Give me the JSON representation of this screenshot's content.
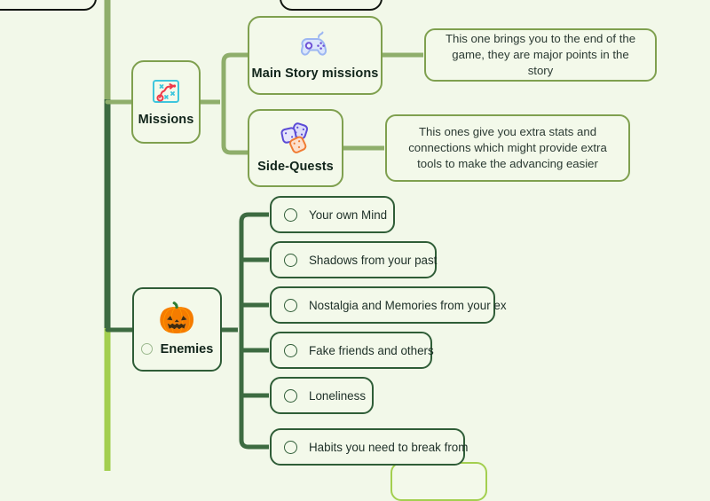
{
  "canvas": {
    "background": "#f2f8e9",
    "trunk_color_upper": "#8fae6b",
    "trunk_color_mid": "#3d6b41",
    "trunk_color_lower": "#a3cf4f",
    "branch_color": "#8fae6b",
    "enemy_branch_color": "#3d6b41"
  },
  "branches": [
    {
      "id": "missions",
      "label": "Missions",
      "icon": "strategy-board-icon",
      "children": [
        {
          "id": "main-story",
          "label": "Main Story missions",
          "icon": "game-controller-icon",
          "note": "This one brings you to the end of the game, they are major points in the story"
        },
        {
          "id": "side-quests",
          "label": "Side-Quests",
          "icon": "dice-icon",
          "note": "This ones give you extra stats and connections which might provide extra tools to make the advancing easier"
        }
      ]
    },
    {
      "id": "enemies",
      "label": "Enemies",
      "icon": "jack-o-lantern-emoji",
      "emoji": "🎃",
      "items": [
        {
          "label": "Your own Mind"
        },
        {
          "label": "Shadows from your past"
        },
        {
          "label": "Nostalgia and Memories from your ex"
        },
        {
          "label": "Fake friends and others"
        },
        {
          "label": "Loneliness"
        },
        {
          "label": "Habits you need to break from"
        }
      ]
    }
  ]
}
